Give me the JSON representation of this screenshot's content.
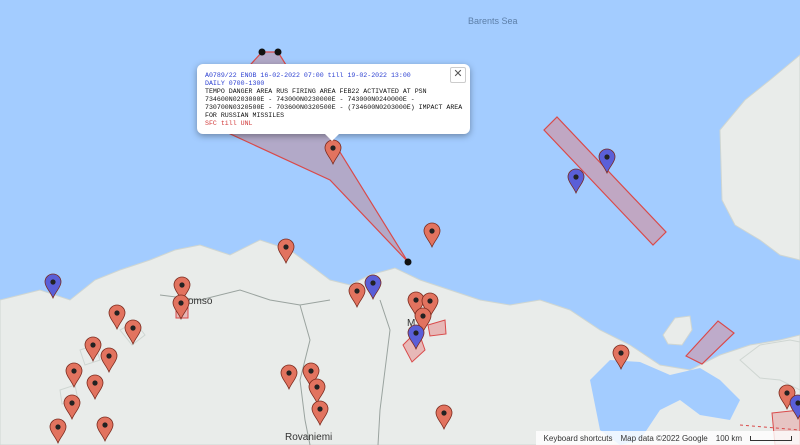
{
  "map": {
    "sea_label": "Barents Sea",
    "city_tromso": "omso",
    "city_murmansk": "M",
    "city_rovaniemi": "Rovaniemi",
    "colors": {
      "water": "#a3ccff",
      "land": "#e9ecea",
      "polygon_fill": "#c08c9a",
      "polygon_stroke": "#d94a4a",
      "pin_red": "#e2735f",
      "pin_blue": "#5a5fd8"
    }
  },
  "popup": {
    "header": "A0789/22 ENOB  16-02-2022 07:00 till 19-02-2022 13:00",
    "schedule": "DAILY 0700-1300",
    "body_lines": [
      "TEMPO DANGER AREA RUS FIRING AREA FEB22 ACTIVATED AT PSN",
      "734600N0203000E - 743000N0230000E - 743000N0240000E -",
      "730700N0320500E - 703600N0320500E - (734600N0203000E) IMPACT AREA",
      "FOR RUSSIAN MISSILES"
    ],
    "limits": "SFC  till UNL",
    "close_glyph": "✕"
  },
  "footer": {
    "shortcuts": "Keyboard shortcuts",
    "attribution": "Map data ©2022 Google",
    "scale": "100 km"
  }
}
